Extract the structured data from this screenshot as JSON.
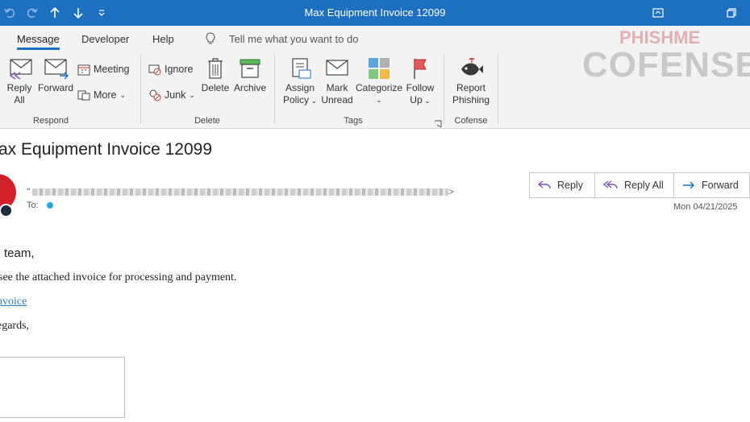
{
  "window": {
    "title": "Max Equipment Invoice 12099"
  },
  "tabs": [
    "Message",
    "Developer",
    "Help"
  ],
  "tell_me": "Tell me what you want to do",
  "watermark": {
    "small": "PHISHME",
    "big": "COFENSE"
  },
  "ribbon": {
    "respond": {
      "label": "Respond",
      "reply_all": [
        "Reply",
        "All"
      ],
      "forward": "Forward",
      "meeting": "Meeting",
      "more": "More"
    },
    "delete": {
      "label": "Delete",
      "ignore": "Ignore",
      "junk": "Junk",
      "delete": "Delete",
      "archive": "Archive"
    },
    "tags": {
      "label": "Tags",
      "assign_policy": [
        "Assign",
        "Policy"
      ],
      "mark_unread": [
        "Mark",
        "Unread"
      ],
      "categorize": "Categorize",
      "follow_up": [
        "Follow",
        "Up"
      ]
    },
    "cofense": {
      "label": "Cofense",
      "report_phishing": [
        "Report",
        "Phishing"
      ]
    }
  },
  "message": {
    "subject": "ax Equipment Invoice 12099",
    "from_prefix": "\"",
    "from_suffix": ">",
    "to_label": "To:",
    "date": "Mon 04/21/2025",
    "actions": {
      "reply": "Reply",
      "reply_all": "Reply All",
      "forward": "Forward"
    },
    "body": {
      "greeting": "team,",
      "line1": "see the attached invoice for processing and payment.",
      "link": "nvoice",
      "closing": "egards,"
    }
  },
  "colors": {
    "accent": "#1d6fc0",
    "avatar": "#d0202a",
    "link": "#2b7fb8"
  }
}
